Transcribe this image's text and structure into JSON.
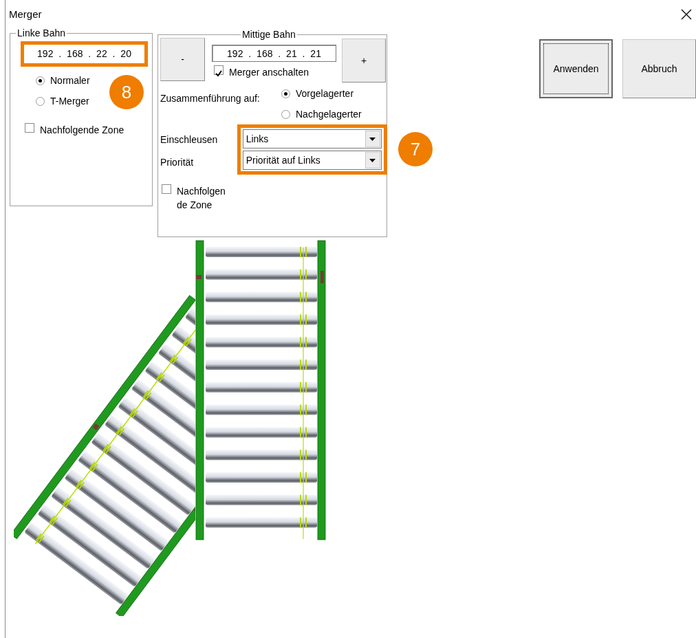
{
  "window": {
    "title": "Merger"
  },
  "left_lane": {
    "title": "Linke Bahn",
    "ip": "192 . 168 . 22 . 20",
    "highlighted": true,
    "mode_options": [
      {
        "label": "Normaler",
        "selected": true
      },
      {
        "label": "T-Merger",
        "selected": false
      }
    ],
    "following_zone": {
      "label": "Nachfolgende Zone",
      "checked": false
    }
  },
  "middle_lane": {
    "title": "Mittige Bahn",
    "minus_button": "-",
    "plus_button": "+",
    "ip": "192 . 168 . 21 . 21",
    "merger_enabled": {
      "label": "Merger anschalten",
      "checked": true
    },
    "merge_label": "Zusammenführung auf:",
    "merge_options": [
      {
        "label": "Vorgelagerter",
        "selected": true
      },
      {
        "label": "Nachgelagerter",
        "selected": false
      }
    ],
    "infeed": {
      "label": "Einschleusen",
      "value": "Links"
    },
    "priority": {
      "label": "Priorität",
      "value": "Priorität auf Links"
    },
    "highlighted": true,
    "following_zone": {
      "label": "Nachfolgen de Zone",
      "checked": false
    }
  },
  "buttons": [
    {
      "label": "Anwenden",
      "default": true
    },
    {
      "label": "Abbruch",
      "default": false
    }
  ],
  "callouts": [
    {
      "label": "8"
    },
    {
      "label": "7"
    }
  ]
}
